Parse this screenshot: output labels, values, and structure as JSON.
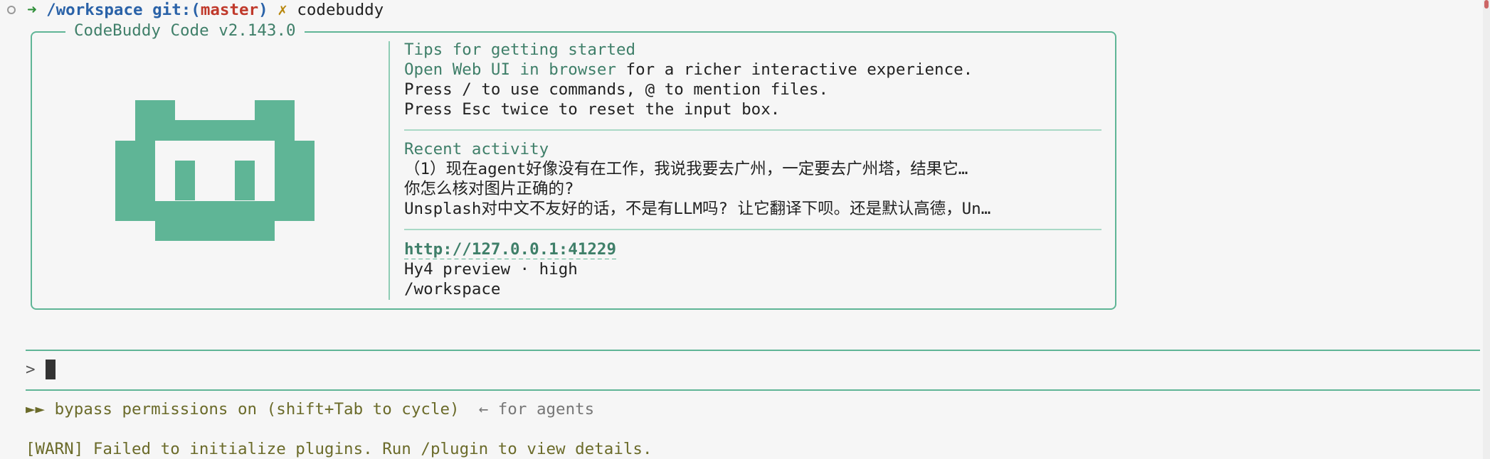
{
  "prompt": {
    "arrow": "➜",
    "cwd": "/workspace",
    "git_prefix": "git:(",
    "branch": "master",
    "git_suffix": ")",
    "dirty_mark": "✗",
    "command": "codebuddy"
  },
  "welcome": {
    "title": "CodeBuddy Code v2.143.0",
    "tips_heading": "Tips for getting started",
    "tip_link": "Open Web UI in browser",
    "tip_link_suffix": " for a richer interactive experience.",
    "tip2": "Press / to use commands, @ to mention files.",
    "tip3": "Press Esc twice to reset the input box.",
    "recent_heading": "Recent activity",
    "recent": [
      "（1）现在agent好像没有在工作，我说我要去广州，一定要去广州塔，结果它…",
      "你怎么核对图片正确的?",
      "Unsplash对中文不友好的话，不是有LLM吗? 让它翻译下呗。还是默认高德，Un…"
    ],
    "url": "http://127.0.0.1:41229",
    "model": "Hy4 preview · high",
    "workdir": "/workspace"
  },
  "input": {
    "prompt_symbol": ">",
    "value": ""
  },
  "status": {
    "bypass": "►► bypass permissions on (shift+Tab to cycle)",
    "bypass_hint": "  ← for agents",
    "warn": "[WARN] Failed to initialize plugins. Run /plugin to view details."
  },
  "colors": {
    "accent": "#5fb596",
    "accent_dark": "#3f7f69",
    "branch": "#c0392b",
    "path": "#2a62a8",
    "warn": "#6b6b2a"
  }
}
